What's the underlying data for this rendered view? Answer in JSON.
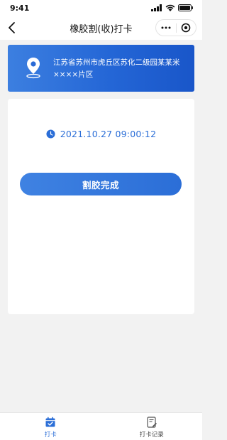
{
  "status_bar": {
    "time": "9:41"
  },
  "nav": {
    "title": "橡胶割(收)打卡"
  },
  "location": {
    "address": "江苏省苏州市虎丘区苏化二级园某某米××××片区"
  },
  "checkin": {
    "datetime": "2021.10.27 09:00:12",
    "button_label": "割胶完成"
  },
  "tabbar": {
    "items": [
      {
        "label": "打卡"
      },
      {
        "label": "打卡记录"
      }
    ]
  },
  "colors": {
    "accent": "#2b6ed7",
    "background": "#f2f2f2"
  }
}
